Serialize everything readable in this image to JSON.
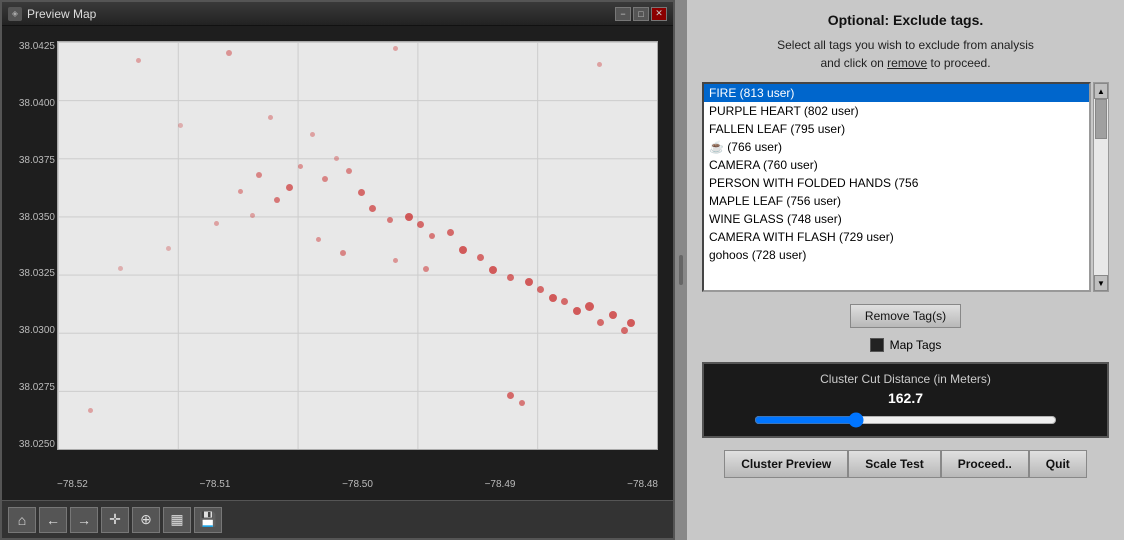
{
  "window": {
    "title": "Preview Map"
  },
  "titlebar": {
    "minimize_label": "−",
    "maximize_label": "□",
    "close_label": "✕"
  },
  "map": {
    "y_labels": [
      "38.0425",
      "38.0400",
      "38.0375",
      "38.0350",
      "38.0325",
      "38.0300",
      "38.0275",
      "38.0250"
    ],
    "x_labels": [
      "−78.52",
      "−78.51",
      "−78.50",
      "−78.49",
      "−78.48"
    ]
  },
  "toolbar": {
    "home_icon": "⌂",
    "back_icon": "←",
    "forward_icon": "→",
    "pan_icon": "✛",
    "zoom_icon": "🔍",
    "grid_icon": "▦",
    "save_icon": "💾"
  },
  "right_panel": {
    "title": "Optional: Exclude tags.",
    "subtitle": "Select all tags you wish to exclude from analysis\nand click on remove to proceed.",
    "tags": [
      {
        "label": "FIRE (813 user)",
        "selected": true
      },
      {
        "label": "PURPLE HEART (802 user)",
        "selected": false
      },
      {
        "label": "FALLEN LEAF (795 user)",
        "selected": false
      },
      {
        "label": "☕ (766 user)",
        "selected": false
      },
      {
        "label": "CAMERA (760 user)",
        "selected": false
      },
      {
        "label": "PERSON WITH FOLDED HANDS (756",
        "selected": false
      },
      {
        "label": "MAPLE LEAF (756 user)",
        "selected": false
      },
      {
        "label": "WINE GLASS (748 user)",
        "selected": false
      },
      {
        "label": "CAMERA WITH FLASH (729 user)",
        "selected": false
      },
      {
        "label": "gohoos (728 user)",
        "selected": false
      }
    ],
    "remove_button": "Remove Tag(s)",
    "map_tags_label": "Map Tags",
    "cluster_section": {
      "label": "Cluster Cut Distance (in Meters)",
      "value": "162.7"
    },
    "buttons": {
      "cluster_preview": "Cluster Preview",
      "scale_test": "Scale Test",
      "proceed": "Proceed..",
      "quit": "Quit"
    }
  }
}
